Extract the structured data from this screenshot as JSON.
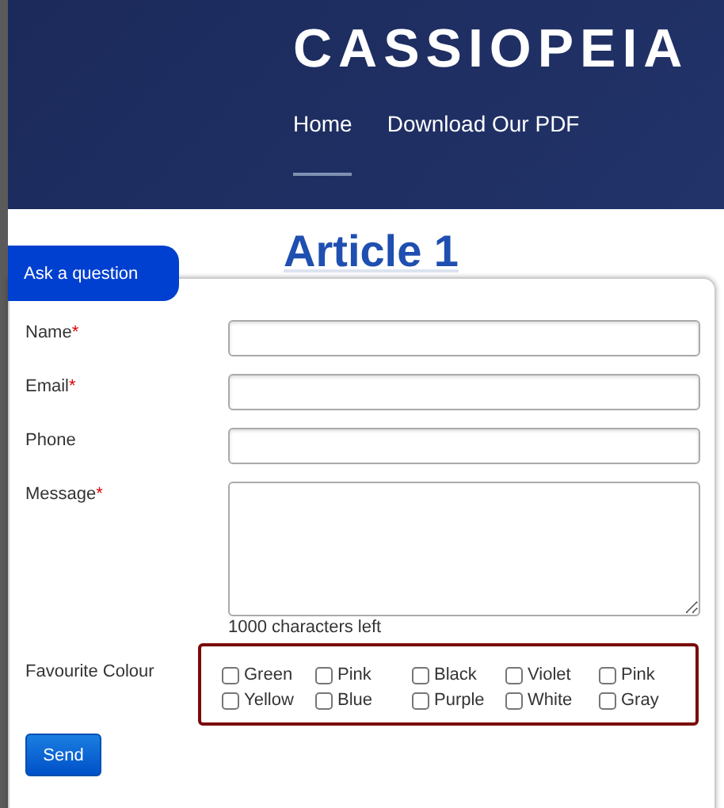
{
  "header": {
    "logo": "CASSIOPEIA",
    "nav": [
      {
        "label": "Home",
        "selected": true
      },
      {
        "label": "Download Our PDF",
        "selected": false
      }
    ]
  },
  "content": {
    "title": "Article 1"
  },
  "popup": {
    "tab": "Ask a question",
    "fields": [
      {
        "label": "Name",
        "required_mark": "*",
        "kind": "text"
      },
      {
        "label": "Email",
        "required_mark": "*",
        "kind": "text"
      },
      {
        "label": "Phone",
        "kind": "text"
      },
      {
        "label": "Message",
        "required_mark": "*",
        "kind": "textarea"
      }
    ],
    "counter": "1000 characters left",
    "colour": {
      "label": "Favourite Colour",
      "options": [
        {
          "label": "Green",
          "checked": false
        },
        {
          "label": "Pink",
          "checked": false
        },
        {
          "label": "Black",
          "checked": false
        },
        {
          "label": "Violet",
          "checked": false
        },
        {
          "label": "Pink",
          "checked": false
        },
        {
          "label": "Yellow",
          "checked": false
        },
        {
          "label": "Blue",
          "checked": false
        },
        {
          "label": "Purple",
          "checked": false
        },
        {
          "label": "White",
          "checked": false
        },
        {
          "label": "Gray",
          "checked": false
        }
      ]
    },
    "send": "Send"
  }
}
